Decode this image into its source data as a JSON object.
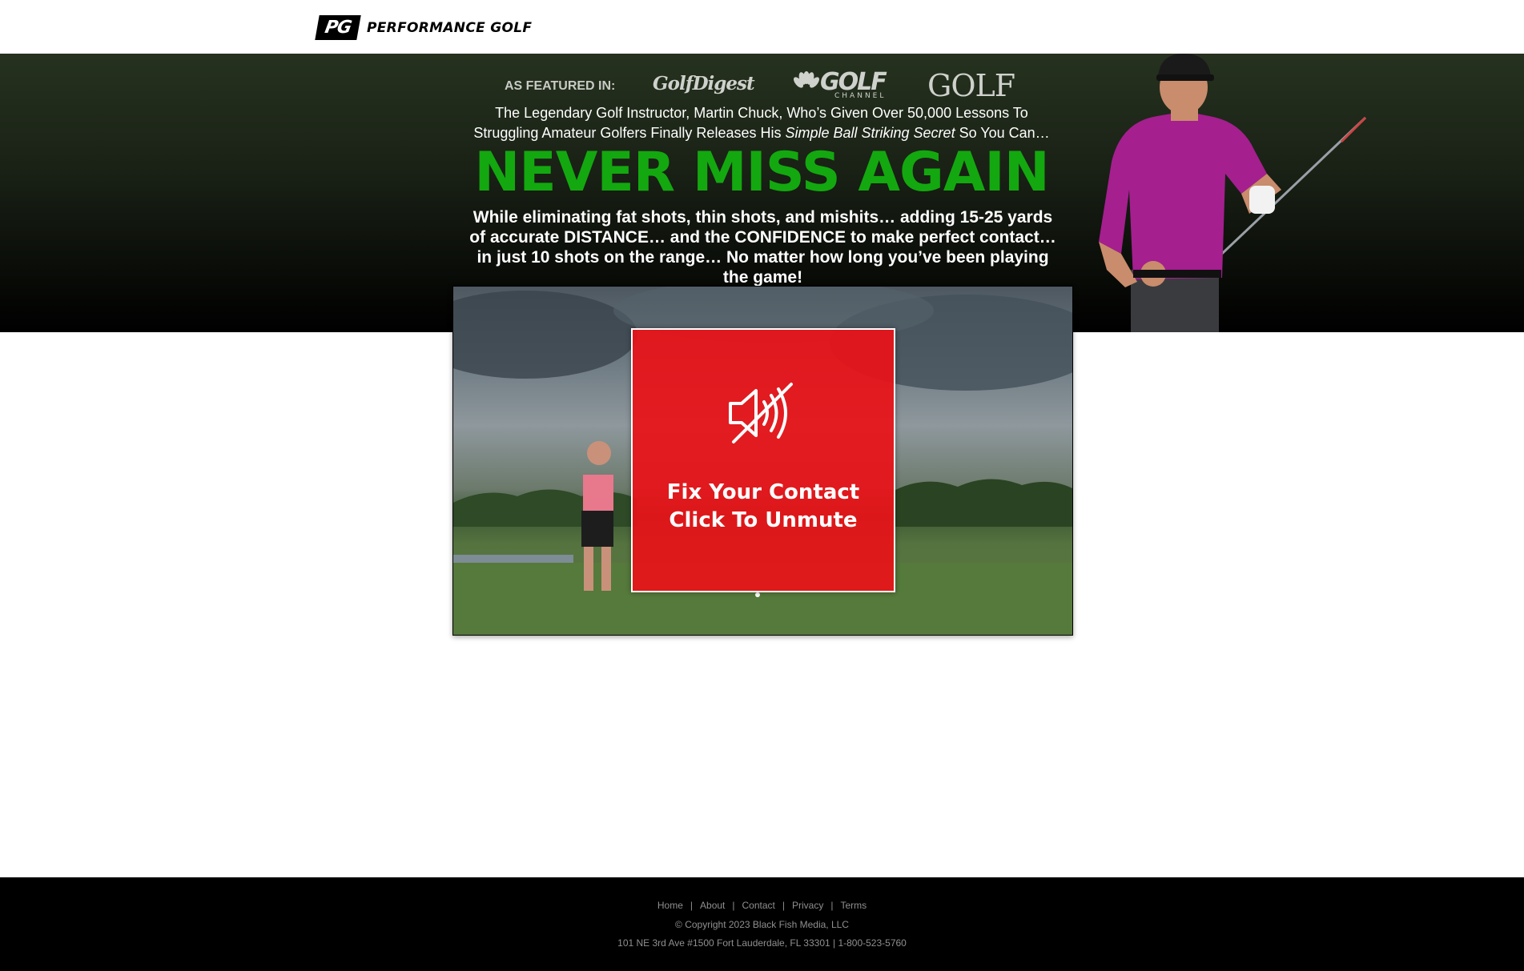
{
  "brand": {
    "badge": "PG",
    "name": "PERFORMANCE GOLF"
  },
  "featured": {
    "label": "AS FEATURED IN:",
    "publications": [
      "GolfDigest",
      "GOLF",
      "CHANNEL",
      "GOLF"
    ]
  },
  "hero": {
    "intro_line1": "The Legendary Golf Instructor, Martin Chuck, Who’s Given Over 50,000 Lessons To",
    "intro_line2_pre": "Struggling Amateur Golfers Finally Releases His ",
    "intro_line2_em": "Simple Ball Striking Secret",
    "intro_line2_post": " So You Can…",
    "headline": "NEVER MISS AGAIN",
    "subheadline": "While eliminating fat shots, thin shots, and mishits… adding 15-25 yards of accurate DISTANCE… and the CONFIDENCE to make perfect contact… in just 10 shots on the range… No matter how long you’ve been playing the game!"
  },
  "video": {
    "overlay_line1": "Fix Your Contact",
    "overlay_line2": "Click To Unmute",
    "icon": "speaker-muted-icon"
  },
  "footer": {
    "links": [
      "Home",
      "About",
      "Contact",
      "Privacy",
      "Terms"
    ],
    "separator": "|",
    "copyright": "© Copyright 2023 Black Fish Media, LLC",
    "address": "101 NE 3rd Ave #1500 Fort Lauderdale, FL 33301 | 1-800-523-5760"
  },
  "colors": {
    "accent_green": "#13a80f",
    "unmute_red": "#e81218",
    "footer_bg": "#000000"
  }
}
